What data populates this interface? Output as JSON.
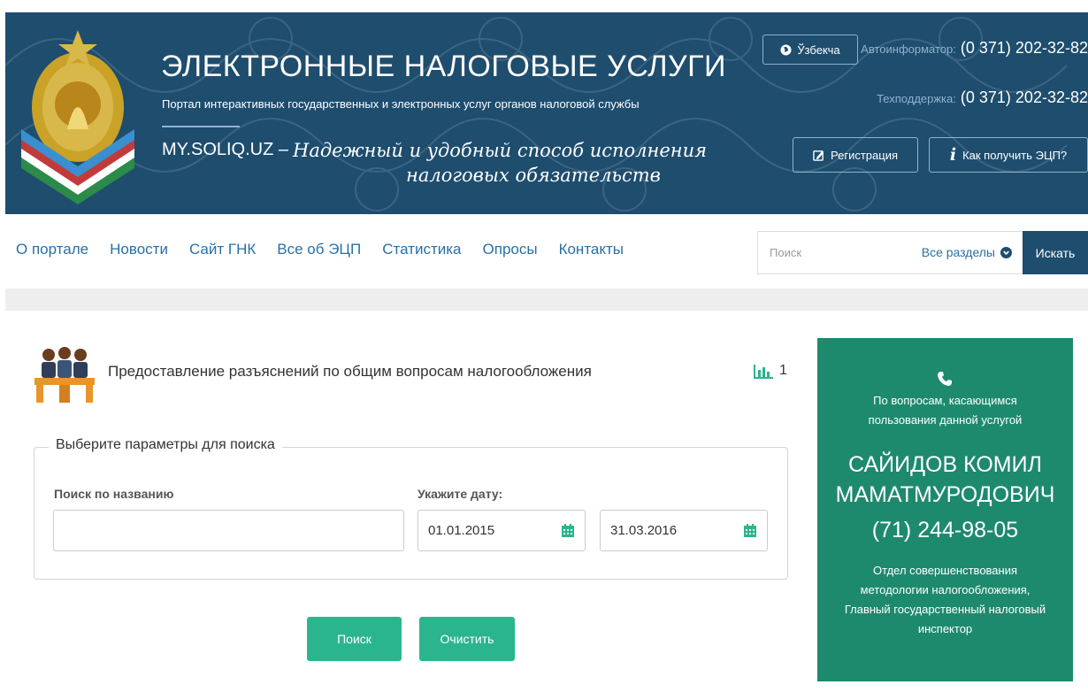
{
  "header": {
    "title": "ЭЛЕКТРОННЫЕ НАЛОГОВЫЕ УСЛУГИ",
    "subtitle": "Портал интерактивных государственных и электронных услуг органов налоговой службы",
    "slogan_host": "MY.SOLIQ.UZ –",
    "slogan_line1": "Надежный и удобный способ исполнения",
    "slogan_line2": "налоговых обязательств",
    "language_button": "Ўзбекча",
    "autoinfo_label": "Автоинформатор:",
    "autoinfo_phone": "(0 371) 202-32-82",
    "support_label": "Техподдержка:",
    "support_phone": "(0 371) 202-32-82",
    "register_button": "Регистрация",
    "ecp_button": "Как получить ЭЦП?"
  },
  "nav": {
    "items": [
      "О портале",
      "Новости",
      "Сайт ГНК",
      "Все об ЭЦП",
      "Статистика",
      "Опросы",
      "Контакты"
    ]
  },
  "search": {
    "placeholder": "Поиск",
    "scope": "Все разделы",
    "button": "Искать"
  },
  "service": {
    "title": "Предоставление разъяснений по общим вопросам налогообложения",
    "stat_count": "1"
  },
  "form": {
    "legend": "Выберите параметры для поиска",
    "name_label": "Поиск по названию",
    "name_value": "",
    "date_label": "Укажите дату:",
    "date_from": "01.01.2015",
    "date_to": "31.03.2016",
    "search_button": "Поиск",
    "clear_button": "Очистить"
  },
  "contact": {
    "question_line1": "По вопросам, касающимся",
    "question_line2": "пользования данной услугой",
    "name_line1": "САЙИДОВ КОМИЛ",
    "name_line2": "МАМАТМУРОДОВИЧ",
    "phone": "(71) 244-98-05",
    "dept_line1": "Отдел совершенствования",
    "dept_line2": "методологии налогообложения,",
    "dept_line3": "Главный государственный налоговый",
    "dept_line4": "инспектор"
  },
  "colors": {
    "header_bg": "#1e4d6e",
    "link": "#2a6fa3",
    "accent_green": "#2bb58e",
    "card_green": "#1e8a6d"
  }
}
